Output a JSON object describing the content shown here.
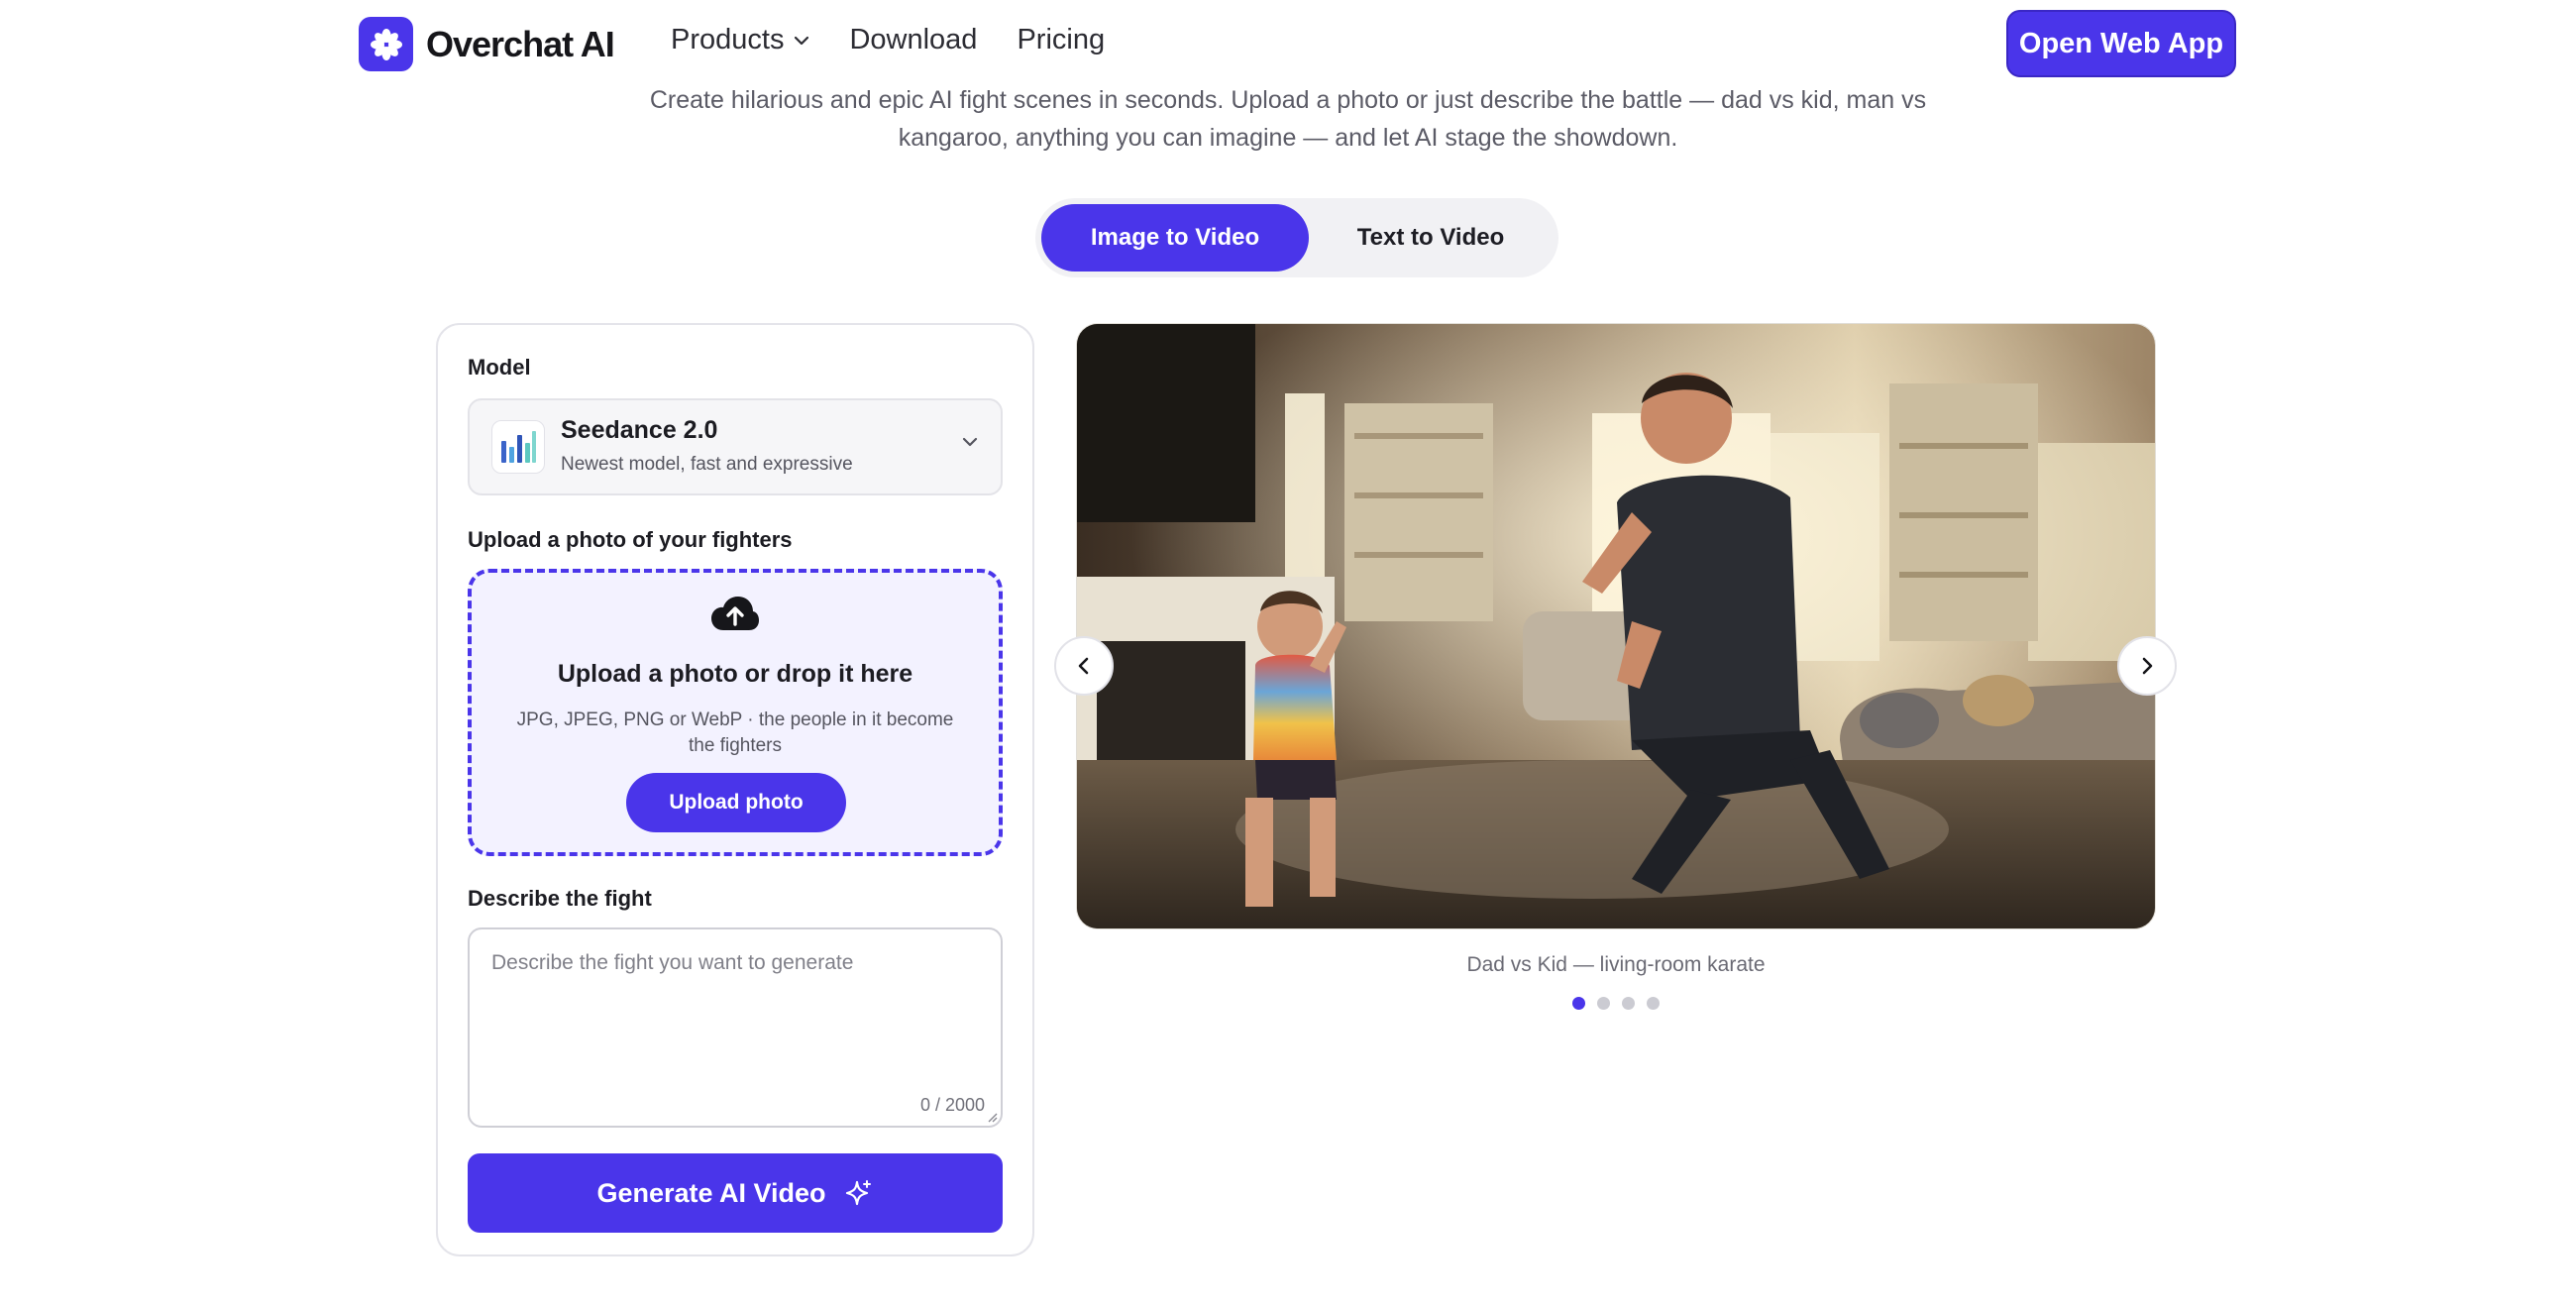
{
  "brand": {
    "name": "Overchat AI",
    "accent_color": "#4a35ea"
  },
  "nav": {
    "links": [
      "Products",
      "Download",
      "Pricing"
    ],
    "cta": "Open Web App"
  },
  "hero": {
    "subtitle_line1": "Create hilarious and epic AI fight scenes in seconds. Upload a photo or just describe the battle — dad vs kid, man vs",
    "subtitle_line2": "kangaroo, anything you can imagine — and let AI stage the showdown."
  },
  "mode_tabs": [
    "Image to Video",
    "Text to Video"
  ],
  "form": {
    "model_label": "Model",
    "model": {
      "name": "Seedance 2.0",
      "description": "Newest model, fast and expressive",
      "icon": "bar-chart-icon"
    },
    "upload_label": "Upload a photo of your fighters",
    "upload": {
      "title": "Upload a photo or drop it here",
      "hint": "JPG, JPEG, PNG or WebP · the people in it become the fighters",
      "button": "Upload photo",
      "icon": "cloud-upload-icon"
    },
    "describe_label": "Describe the fight",
    "describe_placeholder": "Describe the fight you want to generate",
    "char_count": "0 / 2000",
    "generate_button": "Generate AI Video"
  },
  "carousel": {
    "caption": "Dad vs Kid — living-room karate",
    "slide_count": 4,
    "active_slide": 1
  }
}
